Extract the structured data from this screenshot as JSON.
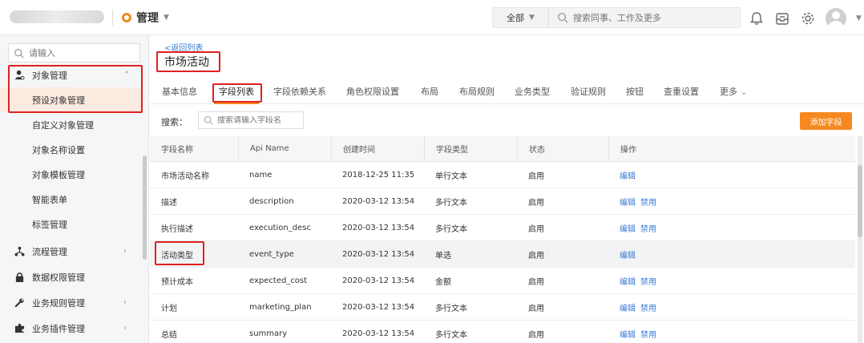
{
  "header": {
    "app_name": "管理",
    "search_scope": "全部",
    "search_placeholder": "搜索同事、工作及更多"
  },
  "sidebar": {
    "search_placeholder": "请输入",
    "object_management": "对象管理",
    "submenu": [
      "预设对象管理",
      "自定义对象管理",
      "对象名称设置",
      "对象模板管理",
      "智能表单",
      "标签管理"
    ],
    "process_management": "流程管理",
    "data_permission": "数据权限管理",
    "business_rules": "业务规则管理",
    "business_plugins": "业务插件管理"
  },
  "main": {
    "back_link": "<返回列表",
    "title": "市场活动",
    "tabs": [
      "基本信息",
      "字段列表",
      "字段依赖关系",
      "角色权限设置",
      "布局",
      "布局规则",
      "业务类型",
      "验证规则",
      "按钮",
      "查重设置",
      "更多"
    ],
    "filter_label": "搜索：",
    "field_search_placeholder": "搜索请输入字段名",
    "add_button": "添加字段"
  },
  "table": {
    "columns": [
      "字段名称",
      "Api Name",
      "创建时间",
      "字段类型",
      "状态",
      "操作"
    ],
    "rows": [
      {
        "name": "市场活动名称",
        "api": "name",
        "created": "2018-12-25 11:35",
        "type": "单行文本",
        "status": "启用",
        "ops": [
          "编辑"
        ]
      },
      {
        "name": "描述",
        "api": "description",
        "created": "2020-03-12 13:54",
        "type": "多行文本",
        "status": "启用",
        "ops": [
          "编辑",
          "禁用"
        ]
      },
      {
        "name": "执行描述",
        "api": "execution_desc",
        "created": "2020-03-12 13:54",
        "type": "多行文本",
        "status": "启用",
        "ops": [
          "编辑",
          "禁用"
        ]
      },
      {
        "name": "活动类型",
        "api": "event_type",
        "created": "2020-03-12 13:54",
        "type": "单选",
        "status": "启用",
        "ops": [
          "编辑"
        ]
      },
      {
        "name": "预计成本",
        "api": "expected_cost",
        "created": "2020-03-12 13:54",
        "type": "金额",
        "status": "启用",
        "ops": [
          "编辑",
          "禁用"
        ]
      },
      {
        "name": "计划",
        "api": "marketing_plan",
        "created": "2020-03-12 13:54",
        "type": "多行文本",
        "status": "启用",
        "ops": [
          "编辑",
          "禁用"
        ]
      },
      {
        "name": "总结",
        "api": "summary",
        "created": "2020-03-12 13:54",
        "type": "多行文本",
        "status": "启用",
        "ops": [
          "编辑",
          "禁用"
        ]
      }
    ]
  },
  "colors": {
    "accent": "#f5891f",
    "link": "#3a7bd5",
    "highlight_box": "#e02020"
  }
}
